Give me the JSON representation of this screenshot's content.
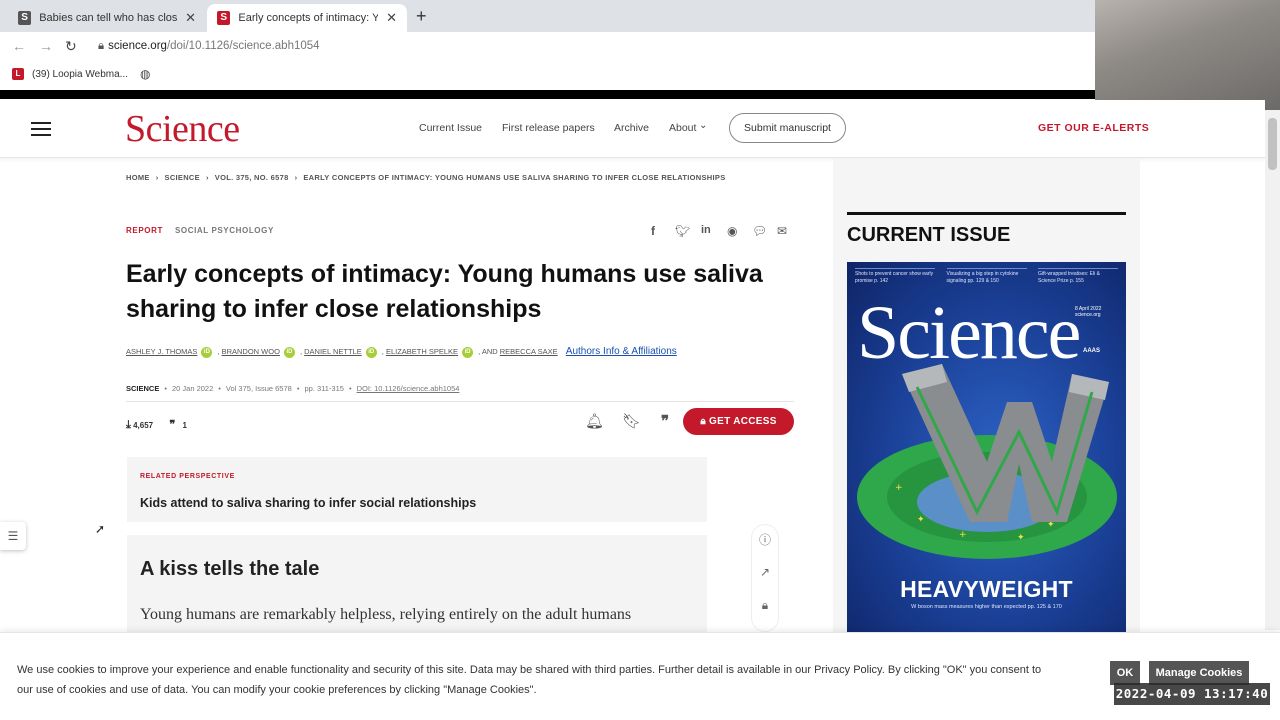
{
  "browser": {
    "tabs": [
      {
        "title": "Babies can tell who has close rel",
        "favicon": "science-news-icon",
        "active": false
      },
      {
        "title": "Early concepts of intimacy: Youn",
        "favicon": "science-s-icon",
        "active": true
      }
    ],
    "url_host": "science.org",
    "url_path": "/doi/10.1126/science.abh1054",
    "bookmark": "(39) Loopia Webma..."
  },
  "header": {
    "logo": "Science",
    "nav": [
      "Current Issue",
      "First release papers",
      "Archive",
      "About"
    ],
    "submit_label": "Submit manuscript",
    "ealerts_label": "GET OUR E-ALERTS",
    "brand_color": "#c3192b"
  },
  "breadcrumb": [
    "HOME",
    "SCIENCE",
    "VOL. 375, NO. 6578",
    "EARLY CONCEPTS OF INTIMACY: YOUNG HUMANS USE SALIVA SHARING TO INFER CLOSE RELATIONSHIPS"
  ],
  "article": {
    "tag_type": "REPORT",
    "tag_subject": "SOCIAL PSYCHOLOGY",
    "title": "Early concepts of intimacy: Young humans use saliva sharing to infer close relationships",
    "authors": [
      "ASHLEY J. THOMAS",
      "BRANDON WOO",
      "DANIEL NETTLE",
      "ELIZABETH SPELKE",
      "REBECCA SAXE"
    ],
    "authors_and": ", AND",
    "affiliations_label": "Authors Info & Affiliations",
    "journal": "SCIENCE",
    "date": "20 Jan 2022",
    "volume": "Vol 375, Issue 6578",
    "pages": "pp. 311-315",
    "doi": "DOI: 10.1126/science.abh1054",
    "downloads": "4,657",
    "citations": "1",
    "get_access_label": "GET ACCESS"
  },
  "related": {
    "label": "RELATED PERSPECTIVE",
    "title": "Kids attend to saliva sharing to infer social relationships"
  },
  "abstract": {
    "heading": "A kiss tells the tale",
    "text": "Young humans are remarkably helpless, relying entirely on the adult humans"
  },
  "sidebar": {
    "heading": "CURRENT ISSUE",
    "cover_logo": "Science",
    "cover_headline": "HEAVYWEIGHT",
    "cover_subline": "W boson mass measures higher than expected  pp. 125 & 170",
    "cover_teasers": [
      "Shots to prevent cancer show early promise  p. 142",
      "Visualizing a big step in cytokine signaling  pp. 129 & 150",
      "Gift-wrapped treatises: Eli & Science Prize  p. 155"
    ],
    "cover_date": "8 April 2022 science.org",
    "cover_aaas": "AAAS"
  },
  "cookie": {
    "text": "We use cookies to improve your experience and enable functionality and security of this site. Data may be shared with third parties. Further detail is available in our Privacy Policy. By clicking \"OK\" you consent to our use of cookies and use of data. You can modify your cookie preferences by clicking \"Manage Cookies\".",
    "ok_label": "OK",
    "manage_label": "Manage Cookies"
  },
  "overlay_timestamp": "2022-04-09  13:17:40"
}
